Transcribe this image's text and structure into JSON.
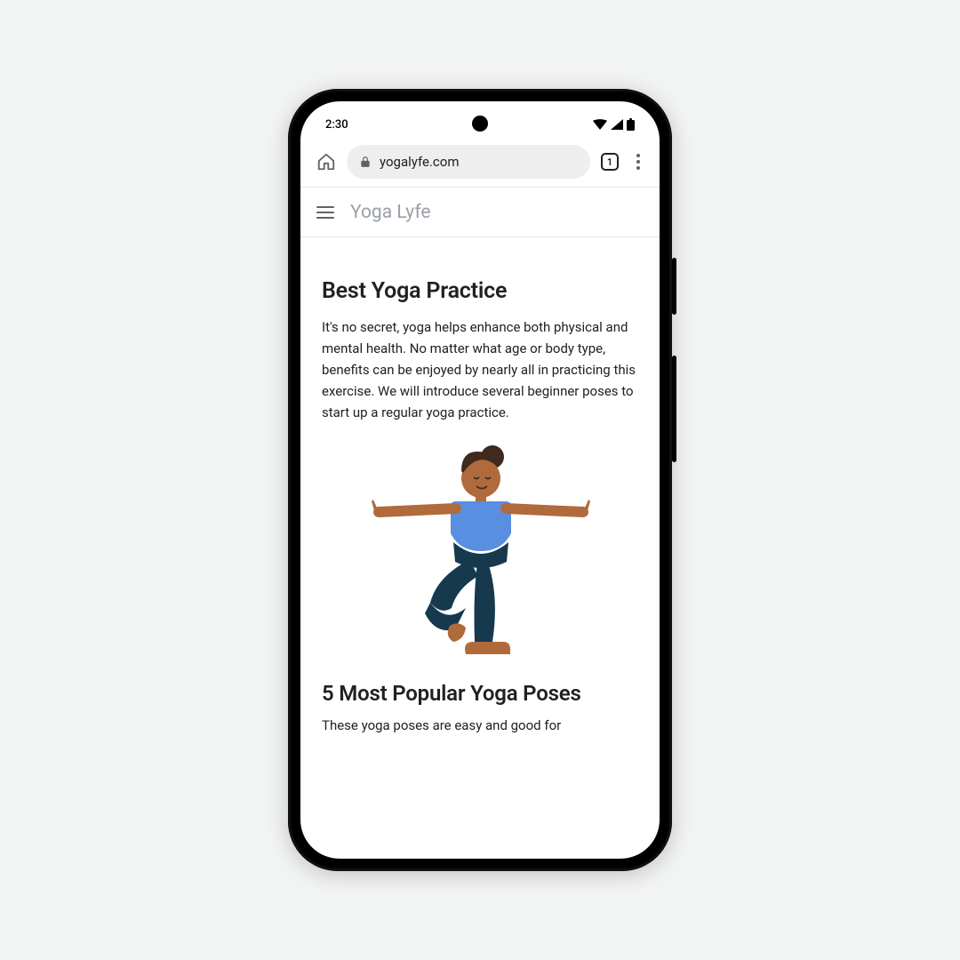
{
  "status": {
    "time": "2:30"
  },
  "browser": {
    "url": "yogalyfe.com",
    "tab_count": "1"
  },
  "site": {
    "name": "Yoga Lyfe"
  },
  "article": {
    "heading": "Best Yoga Practice",
    "intro": "It's no secret, yoga helps enhance both physical and mental health. No matter what age or body type, benefits can be enjoyed by nearly all in practicing this exercise. We will introduce several beginner poses  to start up a regular yoga practice.",
    "subheading": "5 Most Popular Yoga Poses",
    "subtext": "These yoga poses are easy and good for"
  }
}
